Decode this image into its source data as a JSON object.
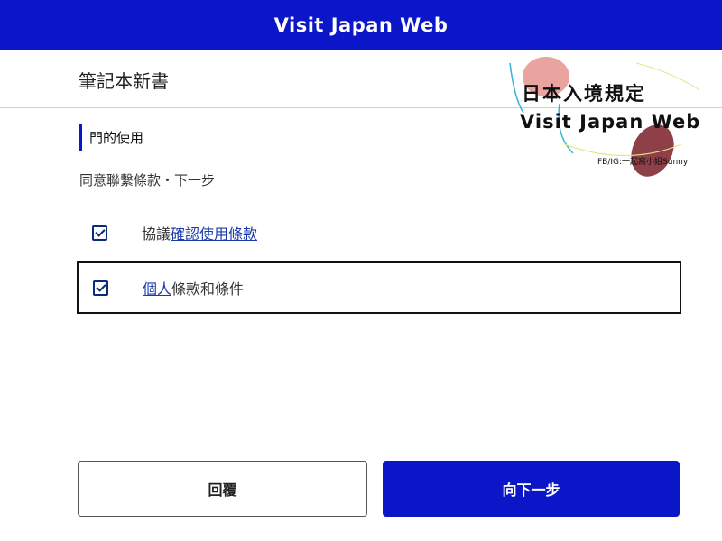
{
  "header": {
    "title": "Visit Japan Web"
  },
  "page": {
    "title": "筆記本新書"
  },
  "section": {
    "heading": "門的使用"
  },
  "instruction": "同意聯繫條款・下一步",
  "checkboxes": [
    {
      "prefix": "協議",
      "link": "確認使用條款",
      "suffix": "",
      "checked": true
    },
    {
      "prefix": "",
      "link": "個人",
      "suffix": "條款和條件",
      "checked": true
    }
  ],
  "buttons": {
    "back": "回覆",
    "next": "向下一步"
  },
  "watermark": {
    "line1": "日本入境規定",
    "line2": "Visit Japan Web",
    "line3": "FB/IG:一起窩小姐Sunny"
  },
  "colors": {
    "brand_blue": "#0a16c8",
    "link_blue": "#1a3aa8"
  }
}
